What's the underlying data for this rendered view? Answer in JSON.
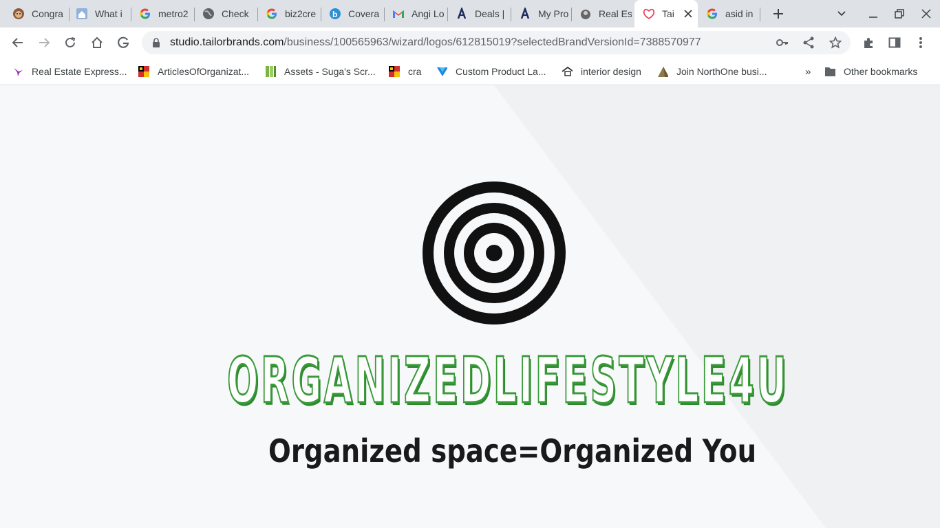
{
  "tabs": [
    {
      "title": "Congra",
      "icon": "monkey-icon"
    },
    {
      "title": "What i",
      "icon": "house-icon"
    },
    {
      "title": "metro2",
      "icon": "google-icon"
    },
    {
      "title": "Check",
      "icon": "globe-icon"
    },
    {
      "title": "biz2cre",
      "icon": "google-icon"
    },
    {
      "title": "Covera",
      "icon": "b-logo-icon"
    },
    {
      "title": "Angi Lo",
      "icon": "gmail-icon"
    },
    {
      "title": "Deals |",
      "icon": "angi-icon"
    },
    {
      "title": "My Pro",
      "icon": "angi-icon"
    },
    {
      "title": "Real Es",
      "icon": "agent-icon"
    },
    {
      "title": "Tai",
      "icon": "tailor-brands-icon",
      "active": true
    },
    {
      "title": "asid in",
      "icon": "google-icon"
    }
  ],
  "address_bar": {
    "host": "studio.tailorbrands.com",
    "path": "/business/100565963/wizard/logos/612815019?selectedBrandVersionId=7388570977"
  },
  "bookmarks": [
    {
      "label": "Real Estate Express...",
      "icon": "hummingbird-icon"
    },
    {
      "label": "ArticlesOfOrganizat...",
      "icon": "maryland-flag-icon"
    },
    {
      "label": "Assets - Suga's Scr...",
      "icon": "green-book-icon"
    },
    {
      "label": "cra",
      "icon": "maryland-flag-icon"
    },
    {
      "label": "Custom Product La...",
      "icon": "vistaprint-icon"
    },
    {
      "label": "interior design",
      "icon": "house-icon"
    },
    {
      "label": "Join NorthOne busi...",
      "icon": "northone-icon"
    }
  ],
  "other_bookmarks": "Other bookmarks",
  "logo": {
    "name": "ORGANIZEDLIFESTYLE4U",
    "slogan": "Organized space=Organized You",
    "name_color": "#3a9b3a"
  }
}
